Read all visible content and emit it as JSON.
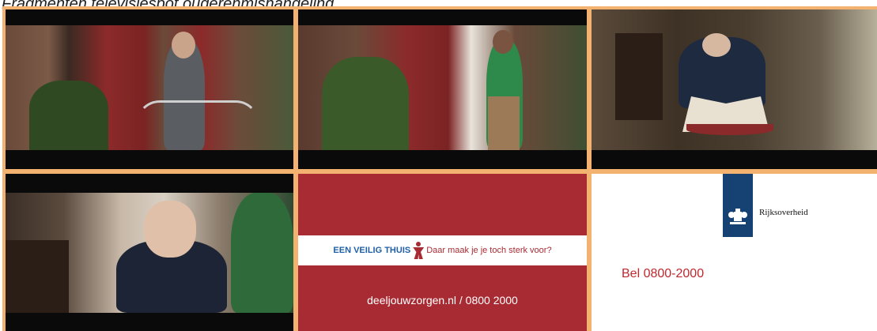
{
  "caption": "Fragmenten televisiespot ouderenmishandeling",
  "frames": [
    {
      "id": "frame-1"
    },
    {
      "id": "frame-2"
    },
    {
      "id": "frame-3"
    },
    {
      "id": "frame-4"
    }
  ],
  "ad": {
    "brand": "EEN VEILIG THUIS",
    "slogan": "Daar maak je je toch sterk voor?",
    "contact": "deeljouwzorgen.nl / 0800 2000",
    "background_color": "#a82b33"
  },
  "government": {
    "name": "Rijksoverheid",
    "phone": "Bel 0800-2000",
    "logo_color": "#154273",
    "phone_color": "#c0282e"
  }
}
